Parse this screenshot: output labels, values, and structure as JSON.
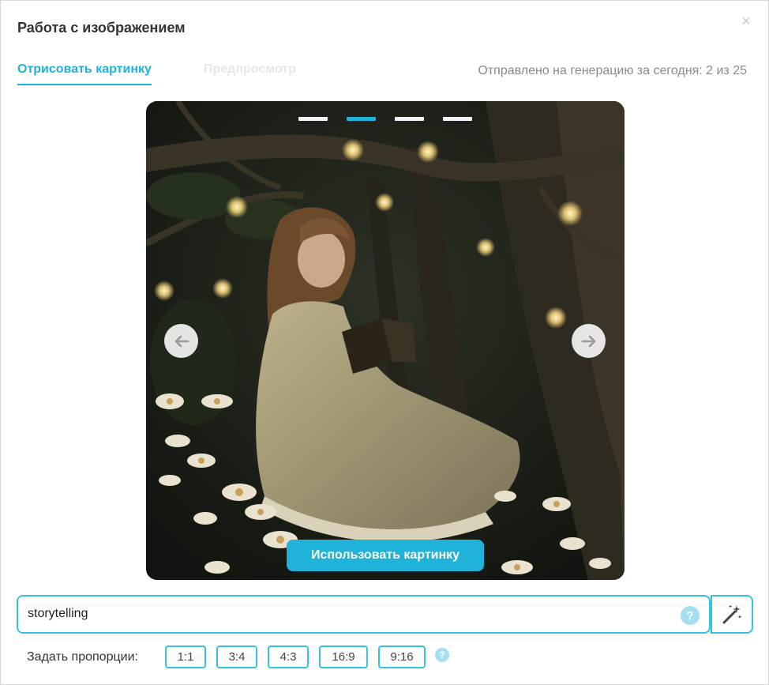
{
  "dialog": {
    "title": "Работа с изображением",
    "close_symbol": "×"
  },
  "tabs": [
    {
      "label": "Отрисовать картинку",
      "active": true
    },
    {
      "label": "Предпросмотр",
      "active": false
    }
  ],
  "quota_text": "Отправлено на генерацию за сегодня: 2 из 25",
  "carousel": {
    "slide_count": 4,
    "active_index": 1,
    "image_subject": "girl reading a book in a night forest",
    "use_button_label": "Использовать картинку",
    "prev_icon": "arrow-left-icon",
    "next_icon": "arrow-right-icon"
  },
  "prompt": {
    "value": "storytelling",
    "help_symbol": "?",
    "magic_icon": "magic-wand-icon"
  },
  "ratios": {
    "label": "Задать пропорции:",
    "options": [
      "1:1",
      "3:4",
      "4:3",
      "16:9",
      "9:16"
    ],
    "help_symbol": "?"
  },
  "colors": {
    "accent": "#1fb3d9",
    "border_accent": "#37c0e0",
    "muted": "#8a8a8a"
  }
}
